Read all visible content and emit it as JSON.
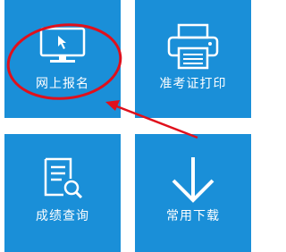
{
  "tiles": [
    {
      "label": "网上报名",
      "icon": "monitor-cursor-icon"
    },
    {
      "label": "准考证打印",
      "icon": "printer-icon"
    },
    {
      "label": "成绩查询",
      "icon": "document-search-icon"
    },
    {
      "label": "常用下载",
      "icon": "download-arrow-icon"
    }
  ],
  "colors": {
    "tile": "#1a8fd8",
    "annotation": "#e0101c",
    "text": "#ffffff"
  }
}
